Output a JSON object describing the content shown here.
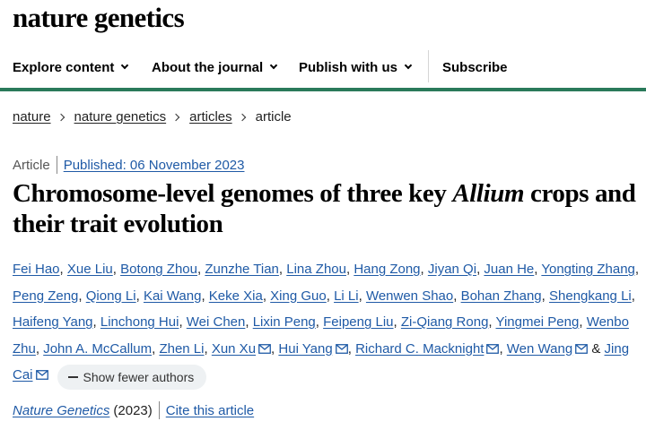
{
  "brand": "nature genetics",
  "nav": {
    "items": [
      {
        "label": "Explore content"
      },
      {
        "label": "About the journal"
      },
      {
        "label": "Publish with us"
      }
    ],
    "subscribe": "Subscribe"
  },
  "breadcrumb": {
    "items": [
      "nature",
      "nature genetics",
      "articles"
    ],
    "current": "article"
  },
  "article": {
    "type": "Article",
    "published": "Published: 06 November 2023",
    "title_part1": "Chromosome-level genomes of three key ",
    "title_italic": "Allium",
    "title_part2": " crops and their trait evolution",
    "authors": [
      "Fei Hao",
      "Xue Liu",
      "Botong Zhou",
      "Zunzhe Tian",
      "Lina Zhou",
      "Hang Zong",
      "Jiyan Qi",
      "Juan He",
      "Yongting Zhang",
      "Peng Zeng",
      "Qiong Li",
      "Kai Wang",
      "Keke Xia",
      "Xing Guo",
      "Li Li",
      "Wenwen Shao",
      "Bohan Zhang",
      "Shengkang Li",
      "Haifeng Yang",
      "Linchong Hui",
      "Wei Chen",
      "Lixin Peng",
      "Feipeng Liu",
      "Zi-Qiang Rong",
      "Yingmei Peng",
      "Wenbo Zhu",
      "John A. McCallum",
      "Zhen Li",
      "Xun Xu",
      "Hui Yang",
      "Richard C. Macknight",
      "Wen Wang",
      "Jing Cai"
    ],
    "mail_authors": [
      "Xun Xu",
      "Hui Yang",
      "Richard C. Macknight",
      "Wen Wang",
      "Jing Cai"
    ],
    "show_fewer": "Show fewer authors",
    "journal": "Nature Genetics",
    "year": "(2023)",
    "cite": "Cite this article"
  },
  "colors": {
    "link": "#1f5aa6",
    "accent_bar": "#2a7a5a"
  }
}
